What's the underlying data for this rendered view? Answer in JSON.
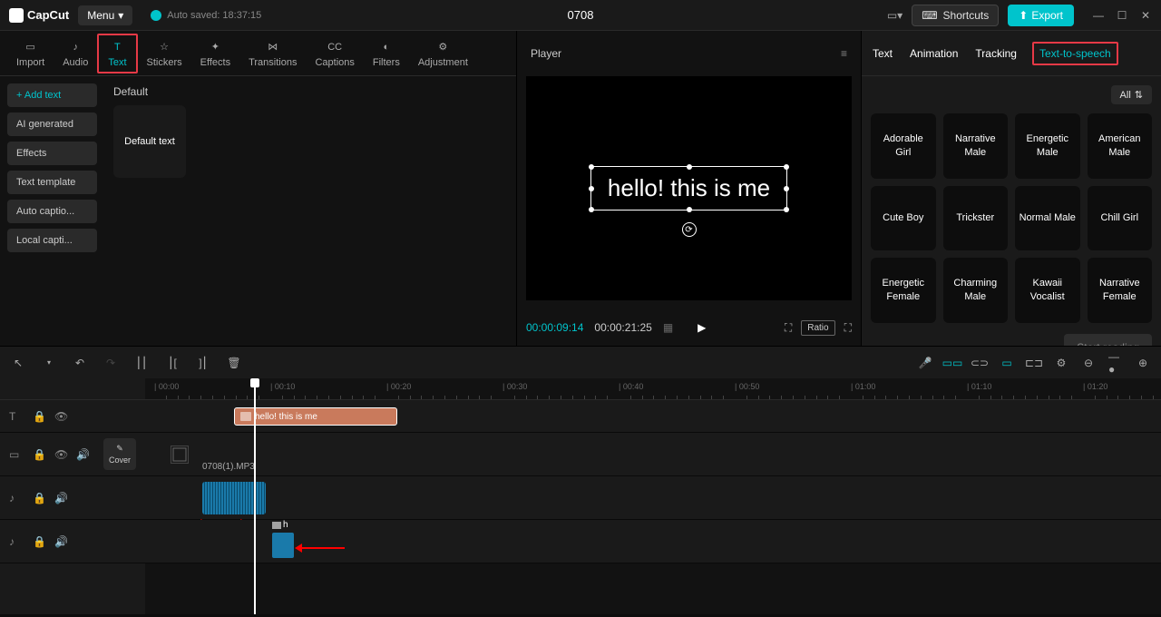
{
  "titlebar": {
    "app_name": "CapCut",
    "menu_label": "Menu",
    "autosave_text": "Auto saved: 18:37:15",
    "project_name": "0708",
    "shortcuts_label": "Shortcuts",
    "export_label": "Export"
  },
  "top_tabs": [
    {
      "label": "Import",
      "active": false
    },
    {
      "label": "Audio",
      "active": false
    },
    {
      "label": "Text",
      "active": true
    },
    {
      "label": "Stickers",
      "active": false
    },
    {
      "label": "Effects",
      "active": false
    },
    {
      "label": "Transitions",
      "active": false
    },
    {
      "label": "Captions",
      "active": false
    },
    {
      "label": "Filters",
      "active": false
    },
    {
      "label": "Adjustment",
      "active": false
    }
  ],
  "sidebar": {
    "items": [
      {
        "label": "Add text",
        "active": true
      },
      {
        "label": "AI generated",
        "active": false
      },
      {
        "label": "Effects",
        "active": false
      },
      {
        "label": "Text template",
        "active": false
      },
      {
        "label": "Auto captio...",
        "active": false
      },
      {
        "label": "Local capti...",
        "active": false
      }
    ]
  },
  "left_content": {
    "section": "Default",
    "preset_label": "Default text"
  },
  "player": {
    "title": "Player",
    "text_content": "hello! this is me",
    "time_current": "00:00:09:14",
    "time_total": "00:00:21:25",
    "ratio_label": "Ratio"
  },
  "right_tabs": [
    {
      "label": "Text",
      "highlighted": false
    },
    {
      "label": "Animation",
      "highlighted": false
    },
    {
      "label": "Tracking",
      "highlighted": false
    },
    {
      "label": "Text-to-speech",
      "highlighted": true
    }
  ],
  "right_panel": {
    "filter_label": "All",
    "voices": [
      "Adorable Girl",
      "Narrative Male",
      "Energetic Male",
      "American Male",
      "Cute Boy",
      "Trickster",
      "Normal Male",
      "Chill Girl",
      "Energetic Female",
      "Charming Male",
      "Kawaii Vocalist",
      "Narrative Female"
    ],
    "start_reading_label": "Start reading"
  },
  "timeline": {
    "ruler_marks": [
      "00:00",
      "00:10",
      "00:20",
      "00:30",
      "00:40",
      "00:50",
      "01:00",
      "01:10",
      "01:20"
    ],
    "cover_label": "Cover",
    "text_clip_label": "hello! this is me",
    "audio_clip_label": "0708(1).MP3",
    "tts_clip_label": "h"
  }
}
